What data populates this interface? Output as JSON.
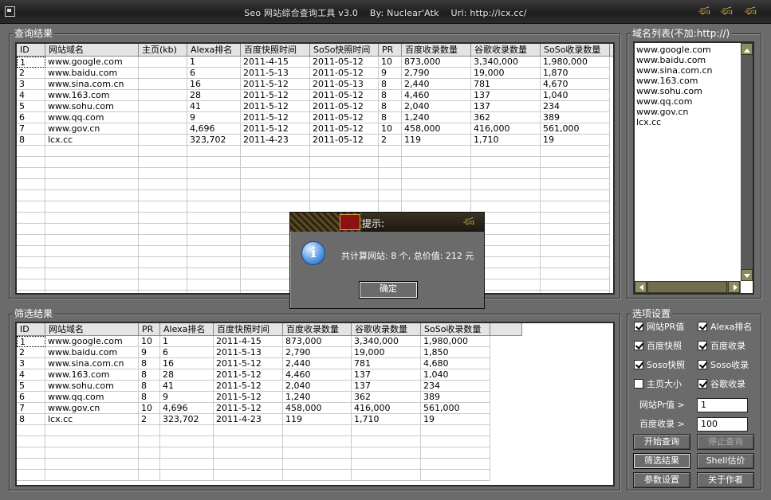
{
  "window": {
    "title": "Seo 网站综合查询工具 v3.0    By: Nuclear'Atk    Url: http://lcx.cc/"
  },
  "query_results": {
    "title": "查询结果",
    "columns": [
      "ID",
      "网站域名",
      "主页(kb)",
      "Alexa排名",
      "百度快照时间",
      "SoSo快照时间",
      "PR",
      "百度收录数量",
      "谷歌收录数量",
      "SoSo收录数量"
    ],
    "rows": [
      [
        "1",
        "www.google.com",
        "",
        "1",
        "2011-4-15",
        "2011-05-12",
        "10",
        "873,000",
        "3,340,000",
        "1,980,000"
      ],
      [
        "2",
        "www.baidu.com",
        "",
        "6",
        "2011-5-13",
        "2011-05-12",
        "9",
        "2,790",
        "19,000",
        "1,870"
      ],
      [
        "3",
        "www.sina.com.cn",
        "",
        "16",
        "2011-5-12",
        "2011-05-13",
        "8",
        "2,440",
        "781",
        "4,670"
      ],
      [
        "4",
        "www.163.com",
        "",
        "28",
        "2011-5-12",
        "2011-05-12",
        "8",
        "4,460",
        "137",
        "1,040"
      ],
      [
        "5",
        "www.sohu.com",
        "",
        "41",
        "2011-5-12",
        "2011-05-12",
        "8",
        "2,040",
        "137",
        "234"
      ],
      [
        "6",
        "www.qq.com",
        "",
        "9",
        "2011-5-12",
        "2011-05-12",
        "8",
        "1,240",
        "362",
        "389"
      ],
      [
        "7",
        "www.gov.cn",
        "",
        "4,696",
        "2011-5-12",
        "2011-05-12",
        "10",
        "458,000",
        "416,000",
        "561,000"
      ],
      [
        "8",
        "lcx.cc",
        "",
        "323,702",
        "2011-4-23",
        "2011-05-12",
        "2",
        "119",
        "1,710",
        "19"
      ]
    ]
  },
  "domain_list": {
    "title": "域名列表(不加:http://)",
    "items": [
      "www.google.com",
      "www.baidu.com",
      "www.sina.com.cn",
      "www.163.com",
      "www.sohu.com",
      "www.qq.com",
      "www.gov.cn",
      "lcx.cc"
    ]
  },
  "filter_results": {
    "title": "筛选结果",
    "columns": [
      "ID",
      "网站域名",
      "PR",
      "Alexa排名",
      "百度快照时间",
      "百度收录数量",
      "谷歌收录数量",
      "SoSo收录数量"
    ],
    "rows": [
      [
        "1",
        "www.google.com",
        "10",
        "1",
        "2011-4-15",
        "873,000",
        "3,340,000",
        "1,980,000"
      ],
      [
        "2",
        "www.baidu.com",
        "9",
        "6",
        "2011-5-13",
        "2,790",
        "19,000",
        "1,850"
      ],
      [
        "3",
        "www.sina.com.cn",
        "8",
        "16",
        "2011-5-12",
        "2,440",
        "781",
        "4,680"
      ],
      [
        "4",
        "www.163.com",
        "8",
        "28",
        "2011-5-12",
        "4,460",
        "137",
        "1,040"
      ],
      [
        "5",
        "www.sohu.com",
        "8",
        "41",
        "2011-5-12",
        "2,040",
        "137",
        "234"
      ],
      [
        "6",
        "www.qq.com",
        "8",
        "9",
        "2011-5-12",
        "1,240",
        "362",
        "389"
      ],
      [
        "7",
        "www.gov.cn",
        "10",
        "4,696",
        "2011-5-12",
        "458,000",
        "416,000",
        "561,000"
      ],
      [
        "8",
        "lcx.cc",
        "2",
        "323,702",
        "2011-4-23",
        "119",
        "1,710",
        "19"
      ]
    ]
  },
  "options": {
    "title": "选项设置",
    "checkboxes": [
      {
        "label": "网站PR值",
        "checked": true
      },
      {
        "label": "Alexa排名",
        "checked": true
      },
      {
        "label": "百度快照",
        "checked": true
      },
      {
        "label": "百度收录",
        "checked": true
      },
      {
        "label": "Soso快照",
        "checked": true
      },
      {
        "label": "Soso收录",
        "checked": true
      },
      {
        "label": "主页大小",
        "checked": false
      },
      {
        "label": "谷歌收录",
        "checked": true
      }
    ],
    "pr_label": "网站Pr值 >",
    "pr_value": "1",
    "baidu_label": "百度收录 >",
    "baidu_value": "100",
    "buttons": {
      "start": "开始查询",
      "stop": "停止查询",
      "filter": "筛选结果",
      "shell": "Shell估价",
      "params": "参数设置",
      "about": "关于作者"
    }
  },
  "dialog": {
    "title": "提示:",
    "message": "共计算网站: 8 个, 总价值: 212 元",
    "ok": "确定"
  }
}
